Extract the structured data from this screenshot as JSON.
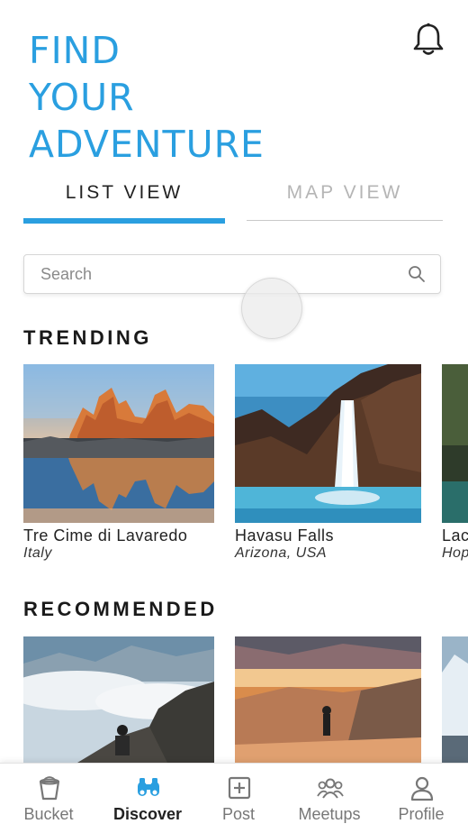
{
  "header": {
    "title_lines": [
      "FIND",
      "YOUR",
      "ADVENTURE"
    ],
    "accent_color": "#2a9fe0"
  },
  "tabs": {
    "list_view": "LIST VIEW",
    "map_view": "MAP VIEW",
    "active": "list_view"
  },
  "search": {
    "placeholder": "Search",
    "value": ""
  },
  "sections": {
    "trending": {
      "title": "TRENDING",
      "items": [
        {
          "name": "Tre Cime di Lavaredo",
          "location": "Italy"
        },
        {
          "name": "Havasu Falls",
          "location": "Arizona, USA"
        },
        {
          "name": "Lac",
          "location": "Hop"
        }
      ]
    },
    "recommended": {
      "title": "RECOMMENDED"
    }
  },
  "bottom_nav": {
    "items": [
      {
        "label": "Bucket",
        "icon": "bucket-icon"
      },
      {
        "label": "Discover",
        "icon": "binoculars-icon",
        "active": true
      },
      {
        "label": "Post",
        "icon": "plus-square-icon"
      },
      {
        "label": "Meetups",
        "icon": "group-icon"
      },
      {
        "label": "Profile",
        "icon": "person-icon"
      }
    ]
  }
}
